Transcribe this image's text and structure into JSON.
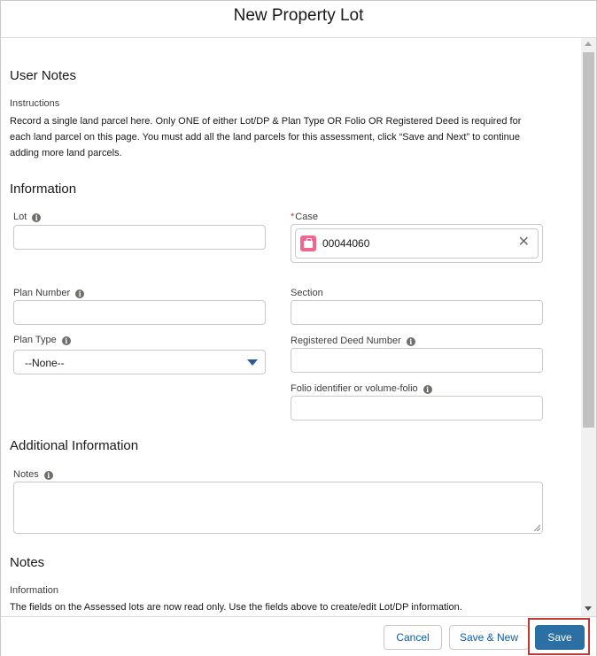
{
  "modal": {
    "title": "New Property Lot"
  },
  "user_notes": {
    "heading": "User Notes",
    "instructions_label": "Instructions",
    "line1": "Record a single land parcel here. Only ONE of either Lot/DP & Plan Type OR Folio OR Registered Deed is required for",
    "line2": "each land parcel on this page. You must add all the land parcels for this assessment, click “Save and Next” to continue",
    "line3": "adding more land parcels."
  },
  "information": {
    "heading": "Information",
    "lot_label": "Lot",
    "lot_value": "",
    "case_label": "Case",
    "case_required_mark": "*",
    "case_value": "00044060",
    "case_remove_glyph": "✕",
    "plan_number_label": "Plan Number",
    "plan_number_value": "",
    "section_label": "Section",
    "section_value": "",
    "plan_type_label": "Plan Type",
    "plan_type_selected": "--None--",
    "registered_deed_label": "Registered Deed Number",
    "registered_deed_value": "",
    "folio_label": "Folio identifier or volume-folio",
    "folio_value": ""
  },
  "additional_information": {
    "heading": "Additional Information",
    "notes_label": "Notes",
    "notes_value": ""
  },
  "notes_section": {
    "heading": "Notes",
    "information_label": "Information",
    "text": "The fields on the Assessed lots are now read only. Use the fields above to create/edit Lot/DP information."
  },
  "footer": {
    "cancel_label": "Cancel",
    "save_new_label": "Save & New",
    "save_label": "Save"
  },
  "icons": {
    "info_glyph": "i",
    "case_icon_color": "#f2658d",
    "brand_color": "#2b6fa3",
    "highlight_color": "#c23934"
  }
}
